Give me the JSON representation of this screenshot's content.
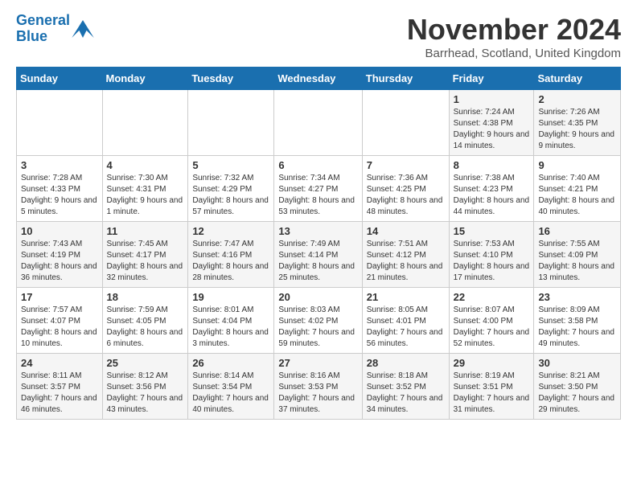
{
  "logo": {
    "line1": "General",
    "line2": "Blue"
  },
  "title": "November 2024",
  "location": "Barrhead, Scotland, United Kingdom",
  "days_of_week": [
    "Sunday",
    "Monday",
    "Tuesday",
    "Wednesday",
    "Thursday",
    "Friday",
    "Saturday"
  ],
  "weeks": [
    [
      {
        "day": "",
        "info": ""
      },
      {
        "day": "",
        "info": ""
      },
      {
        "day": "",
        "info": ""
      },
      {
        "day": "",
        "info": ""
      },
      {
        "day": "",
        "info": ""
      },
      {
        "day": "1",
        "info": "Sunrise: 7:24 AM\nSunset: 4:38 PM\nDaylight: 9 hours and 14 minutes."
      },
      {
        "day": "2",
        "info": "Sunrise: 7:26 AM\nSunset: 4:35 PM\nDaylight: 9 hours and 9 minutes."
      }
    ],
    [
      {
        "day": "3",
        "info": "Sunrise: 7:28 AM\nSunset: 4:33 PM\nDaylight: 9 hours and 5 minutes."
      },
      {
        "day": "4",
        "info": "Sunrise: 7:30 AM\nSunset: 4:31 PM\nDaylight: 9 hours and 1 minute."
      },
      {
        "day": "5",
        "info": "Sunrise: 7:32 AM\nSunset: 4:29 PM\nDaylight: 8 hours and 57 minutes."
      },
      {
        "day": "6",
        "info": "Sunrise: 7:34 AM\nSunset: 4:27 PM\nDaylight: 8 hours and 53 minutes."
      },
      {
        "day": "7",
        "info": "Sunrise: 7:36 AM\nSunset: 4:25 PM\nDaylight: 8 hours and 48 minutes."
      },
      {
        "day": "8",
        "info": "Sunrise: 7:38 AM\nSunset: 4:23 PM\nDaylight: 8 hours and 44 minutes."
      },
      {
        "day": "9",
        "info": "Sunrise: 7:40 AM\nSunset: 4:21 PM\nDaylight: 8 hours and 40 minutes."
      }
    ],
    [
      {
        "day": "10",
        "info": "Sunrise: 7:43 AM\nSunset: 4:19 PM\nDaylight: 8 hours and 36 minutes."
      },
      {
        "day": "11",
        "info": "Sunrise: 7:45 AM\nSunset: 4:17 PM\nDaylight: 8 hours and 32 minutes."
      },
      {
        "day": "12",
        "info": "Sunrise: 7:47 AM\nSunset: 4:16 PM\nDaylight: 8 hours and 28 minutes."
      },
      {
        "day": "13",
        "info": "Sunrise: 7:49 AM\nSunset: 4:14 PM\nDaylight: 8 hours and 25 minutes."
      },
      {
        "day": "14",
        "info": "Sunrise: 7:51 AM\nSunset: 4:12 PM\nDaylight: 8 hours and 21 minutes."
      },
      {
        "day": "15",
        "info": "Sunrise: 7:53 AM\nSunset: 4:10 PM\nDaylight: 8 hours and 17 minutes."
      },
      {
        "day": "16",
        "info": "Sunrise: 7:55 AM\nSunset: 4:09 PM\nDaylight: 8 hours and 13 minutes."
      }
    ],
    [
      {
        "day": "17",
        "info": "Sunrise: 7:57 AM\nSunset: 4:07 PM\nDaylight: 8 hours and 10 minutes."
      },
      {
        "day": "18",
        "info": "Sunrise: 7:59 AM\nSunset: 4:05 PM\nDaylight: 8 hours and 6 minutes."
      },
      {
        "day": "19",
        "info": "Sunrise: 8:01 AM\nSunset: 4:04 PM\nDaylight: 8 hours and 3 minutes."
      },
      {
        "day": "20",
        "info": "Sunrise: 8:03 AM\nSunset: 4:02 PM\nDaylight: 7 hours and 59 minutes."
      },
      {
        "day": "21",
        "info": "Sunrise: 8:05 AM\nSunset: 4:01 PM\nDaylight: 7 hours and 56 minutes."
      },
      {
        "day": "22",
        "info": "Sunrise: 8:07 AM\nSunset: 4:00 PM\nDaylight: 7 hours and 52 minutes."
      },
      {
        "day": "23",
        "info": "Sunrise: 8:09 AM\nSunset: 3:58 PM\nDaylight: 7 hours and 49 minutes."
      }
    ],
    [
      {
        "day": "24",
        "info": "Sunrise: 8:11 AM\nSunset: 3:57 PM\nDaylight: 7 hours and 46 minutes."
      },
      {
        "day": "25",
        "info": "Sunrise: 8:12 AM\nSunset: 3:56 PM\nDaylight: 7 hours and 43 minutes."
      },
      {
        "day": "26",
        "info": "Sunrise: 8:14 AM\nSunset: 3:54 PM\nDaylight: 7 hours and 40 minutes."
      },
      {
        "day": "27",
        "info": "Sunrise: 8:16 AM\nSunset: 3:53 PM\nDaylight: 7 hours and 37 minutes."
      },
      {
        "day": "28",
        "info": "Sunrise: 8:18 AM\nSunset: 3:52 PM\nDaylight: 7 hours and 34 minutes."
      },
      {
        "day": "29",
        "info": "Sunrise: 8:19 AM\nSunset: 3:51 PM\nDaylight: 7 hours and 31 minutes."
      },
      {
        "day": "30",
        "info": "Sunrise: 8:21 AM\nSunset: 3:50 PM\nDaylight: 7 hours and 29 minutes."
      }
    ]
  ]
}
